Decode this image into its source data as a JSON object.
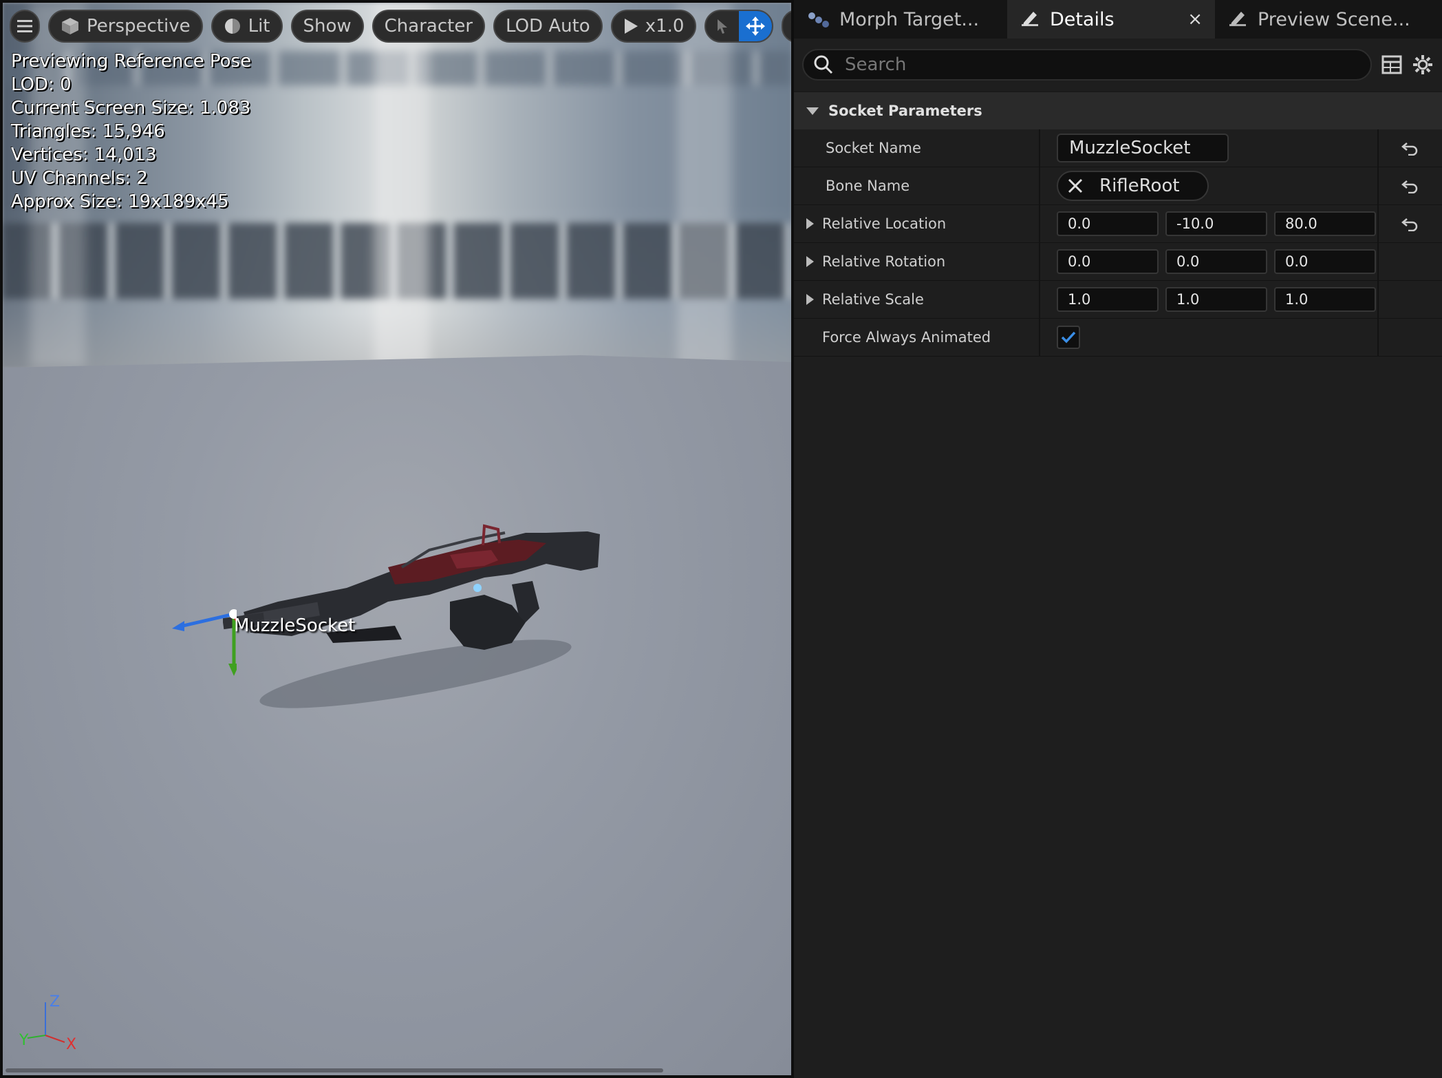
{
  "viewport": {
    "toolbar": {
      "menu_icon": "hamburger-icon",
      "perspective_label": "Perspective",
      "lit_label": "Lit",
      "show_label": "Show",
      "character_label": "Character",
      "lod_label": "LOD Auto",
      "playback_label": "x1.0"
    },
    "stats": [
      "Previewing Reference Pose",
      "LOD: 0",
      "Current Screen Size: 1.083",
      "Triangles: 15,946",
      "Vertices: 14,013",
      "UV Channels: 2",
      "Approx Size: 19x189x45"
    ],
    "socket_label": "MuzzleSocket",
    "axis_labels": {
      "z": "Z",
      "y": "Y",
      "x": "X"
    }
  },
  "panel": {
    "tabs": [
      {
        "label": "Morph Target...",
        "icon": "morph-target-icon"
      },
      {
        "label": "Details",
        "icon": "details-pencil-icon",
        "active": true
      },
      {
        "label": "Preview Scene...",
        "icon": "preview-scene-pencil-icon"
      }
    ],
    "close_glyph": "×",
    "search": {
      "placeholder": "Search",
      "value": ""
    },
    "section": {
      "title": "Socket Parameters"
    },
    "rows": {
      "socket_name": {
        "label": "Socket Name",
        "value": "MuzzleSocket"
      },
      "bone_name": {
        "label": "Bone Name",
        "value": "RifleRoot"
      },
      "relative_location": {
        "label": "Relative Location",
        "values": [
          "0.0",
          "-10.0",
          "80.0"
        ]
      },
      "relative_rotation": {
        "label": "Relative Rotation",
        "values": [
          "0.0",
          "0.0",
          "0.0"
        ]
      },
      "relative_scale": {
        "label": "Relative Scale",
        "values": [
          "1.0",
          "1.0",
          "1.0"
        ]
      },
      "force_always_animated": {
        "label": "Force Always Animated",
        "checked": true
      }
    }
  },
  "colors": {
    "accent": "#1a6fd0",
    "panel_bg": "#1e1e1e",
    "check": "#3a8ee6"
  }
}
